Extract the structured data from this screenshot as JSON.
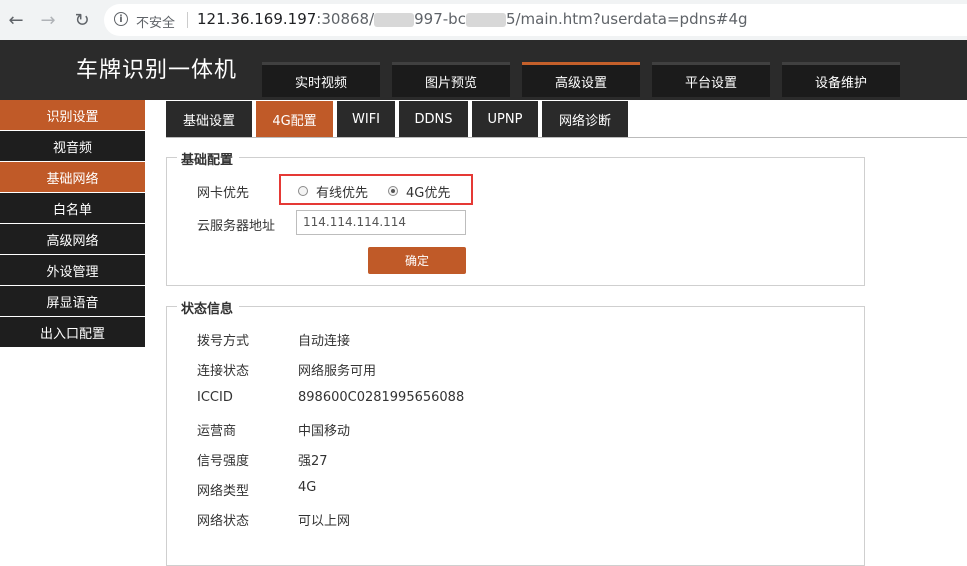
{
  "browser": {
    "insecure_label": "不安全",
    "url_host": "121.36.169.197",
    "url_port": ":30868/",
    "url_part2": "997-bc",
    "url_part3": "5/main.htm?userdata=pdns#4g"
  },
  "app": {
    "title": "车牌识别一体机"
  },
  "main_tabs": [
    {
      "label": "实时视频"
    },
    {
      "label": "图片预览"
    },
    {
      "label": "高级设置",
      "active": true
    },
    {
      "label": "平台设置"
    },
    {
      "label": "设备维护"
    }
  ],
  "sidebar": [
    {
      "label": "识别设置",
      "active": true
    },
    {
      "label": "视音频"
    },
    {
      "label": "基础网络",
      "active": true
    },
    {
      "label": "白名单"
    },
    {
      "label": "高级网络"
    },
    {
      "label": "外设管理"
    },
    {
      "label": "屏显语音"
    },
    {
      "label": "出入口配置"
    }
  ],
  "sub_tabs": [
    {
      "label": "基础设置"
    },
    {
      "label": "4G配置",
      "active": true
    },
    {
      "label": "WIFI"
    },
    {
      "label": "DDNS"
    },
    {
      "label": "UPNP"
    },
    {
      "label": "网络诊断"
    }
  ],
  "basic_config": {
    "legend": "基础配置",
    "nic_priority_label": "网卡优先",
    "options": [
      {
        "label": "有线优先",
        "checked": false
      },
      {
        "label": "4G优先",
        "checked": true
      }
    ],
    "cloud_server_label": "云服务器地址",
    "cloud_server_value": "114.114.114.114",
    "confirm_label": "确定"
  },
  "status_info": {
    "legend": "状态信息",
    "rows": [
      {
        "label": "拨号方式",
        "value": "自动连接"
      },
      {
        "label": "连接状态",
        "value": "网络服务可用"
      },
      {
        "label": "ICCID",
        "value": "898600C0281995656088"
      },
      {
        "label": "运营商",
        "value": "中国移动"
      },
      {
        "label": "信号强度",
        "value": "强27"
      },
      {
        "label": "网络类型",
        "value": "4G"
      },
      {
        "label": "网络状态",
        "value": "可以上网"
      }
    ]
  },
  "colors": {
    "accent": "#c05a28",
    "header_bg": "#2b2b2b",
    "highlight": "#e53935"
  }
}
